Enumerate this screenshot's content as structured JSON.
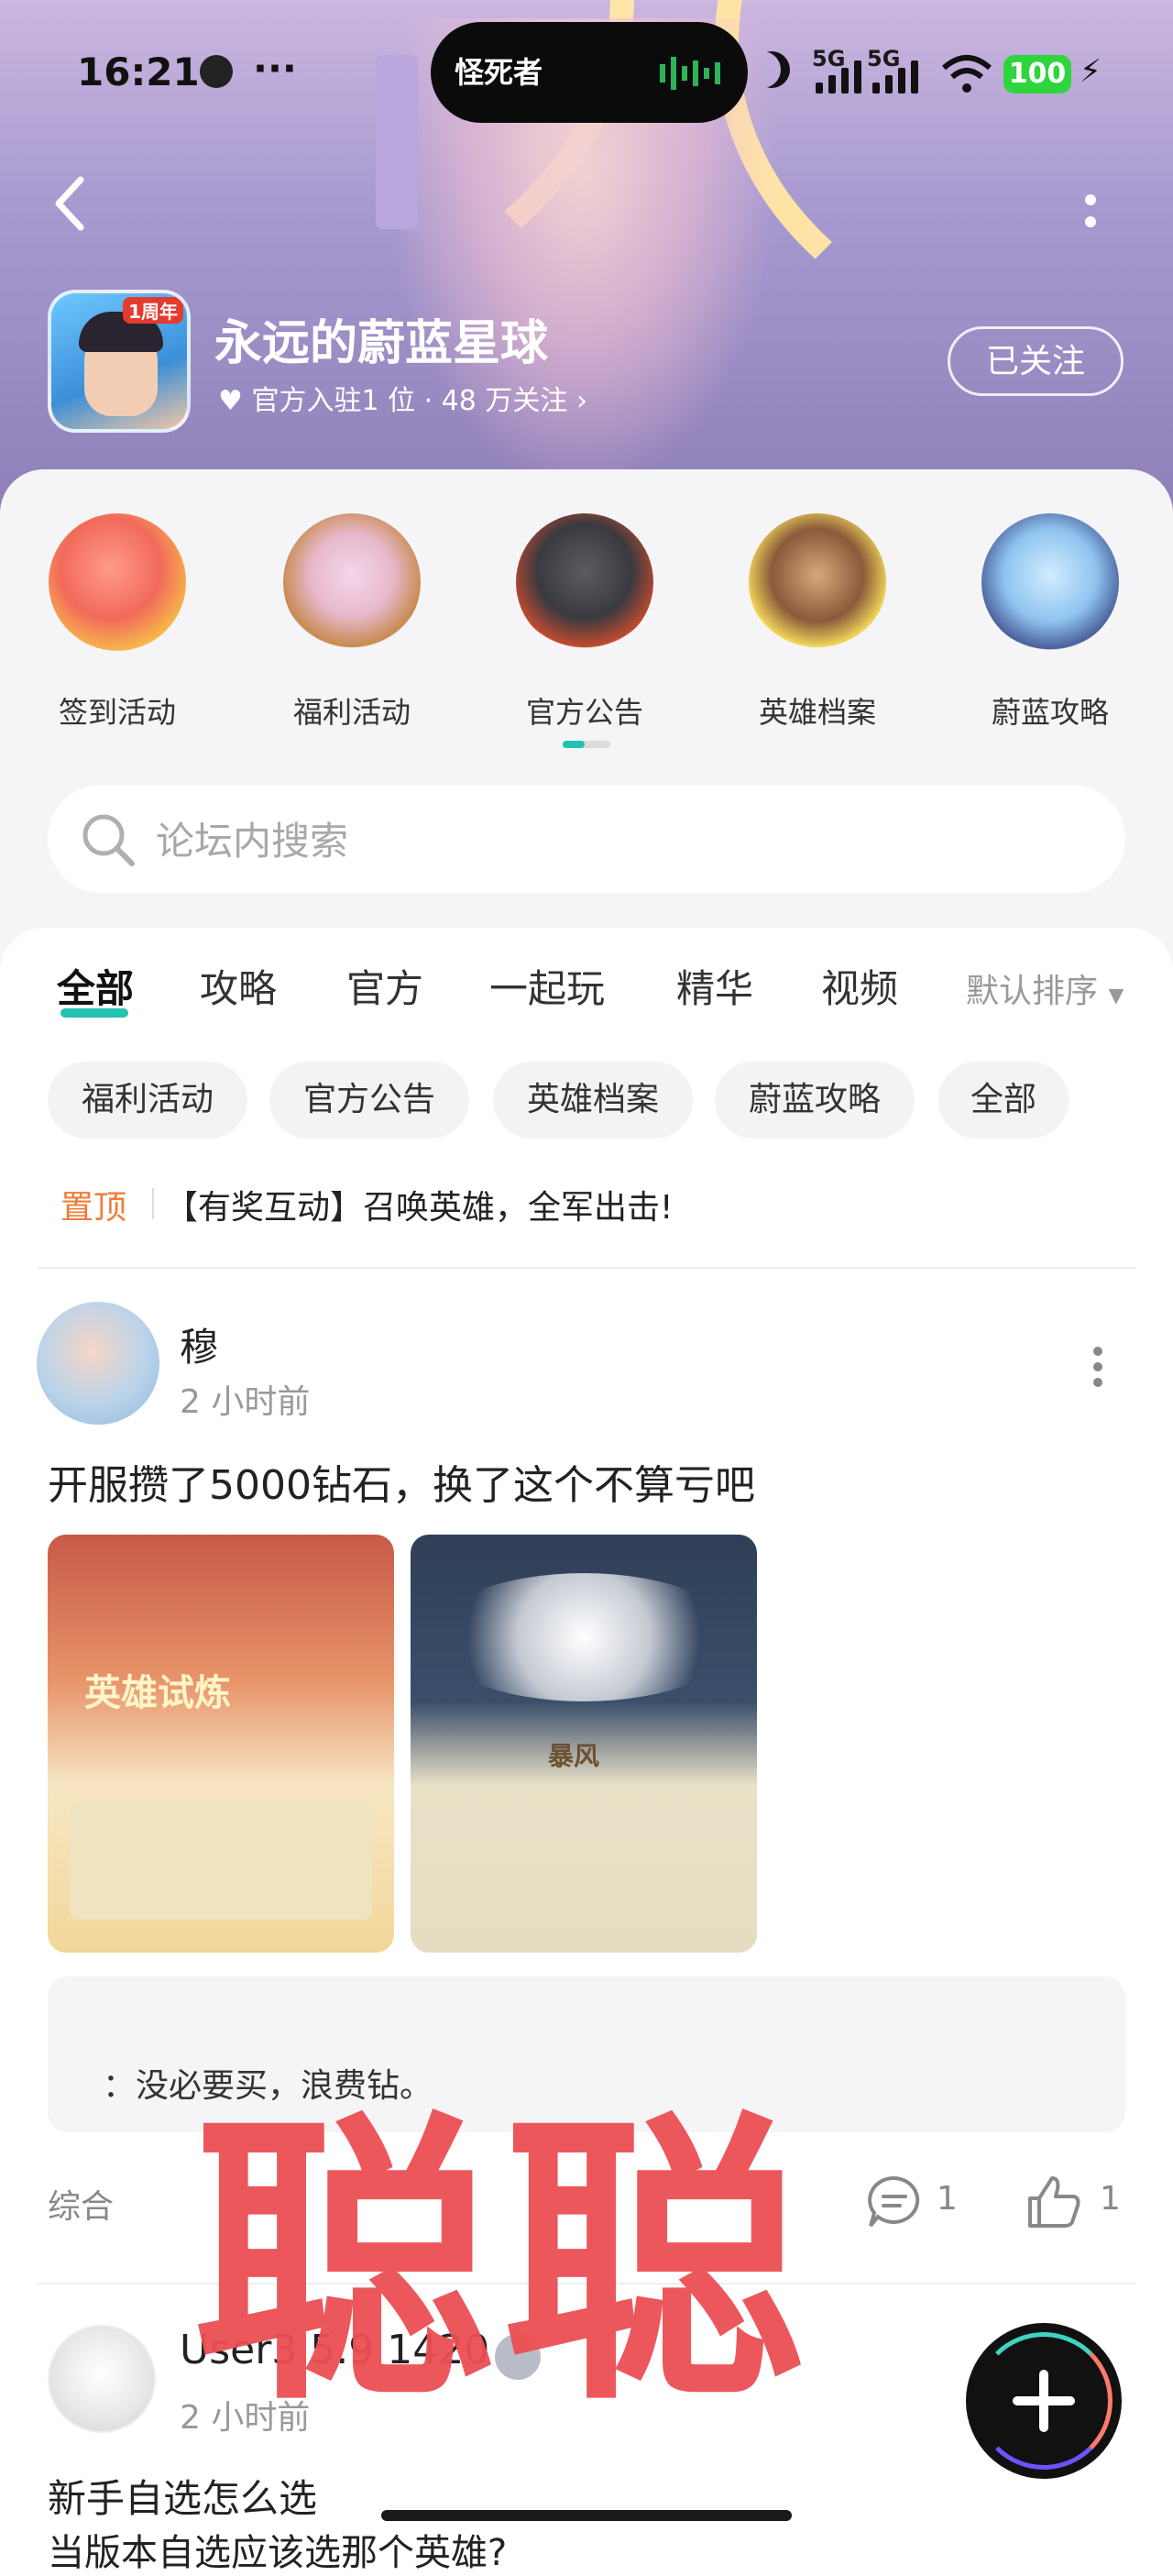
{
  "status_bar": {
    "time": "16:21",
    "dots": "···",
    "island_logo": "怪死者",
    "network1": "5G",
    "network2": "5G",
    "battery": "100"
  },
  "header": {
    "title": "永远的蔚蓝星球",
    "stats": "官方入驻1 位 · 48 万关注",
    "follow_label": "已关注",
    "icon_badge": "1周年"
  },
  "categories": [
    {
      "label": "签到活动",
      "icon": "mermaid-gift-icon"
    },
    {
      "label": "福利活动",
      "icon": "bear-girl-icon"
    },
    {
      "label": "官方公告",
      "icon": "wolf-knight-icon"
    },
    {
      "label": "英雄档案",
      "icon": "laurel-hero-icon"
    },
    {
      "label": "蔚蓝攻略",
      "icon": "fan-witch-icon"
    }
  ],
  "search": {
    "placeholder": "论坛内搜索"
  },
  "tabs": [
    "全部",
    "攻略",
    "官方",
    "一起玩",
    "精华",
    "视频"
  ],
  "sort_label": "默认排序",
  "chips": [
    "福利活动",
    "官方公告",
    "英雄档案",
    "蔚蓝攻略",
    "全部"
  ],
  "pinned": {
    "label": "置顶",
    "title": "【有奖互动】召唤英雄，全军出击!"
  },
  "post1": {
    "user": "穆",
    "time": "2 小时前",
    "title": "开服攒了5000钻石，换了这个不算亏吧",
    "image1_text": "英雄试炼",
    "image2_text": "暴风",
    "reply": "：没必要买，浪费钻。",
    "tag": "综合",
    "comments": "1",
    "likes": "1"
  },
  "watermark": "聪聪",
  "post2": {
    "user": "User3  5.9 1420",
    "time": "2 小时前",
    "title": "新手自选怎么选",
    "line2": "当版本自选应该选那个英雄?"
  },
  "colors": {
    "accent": "#22c1b0",
    "pinned": "#f07b3a",
    "watermark": "#ec4f54",
    "battery": "#2fd53c"
  }
}
